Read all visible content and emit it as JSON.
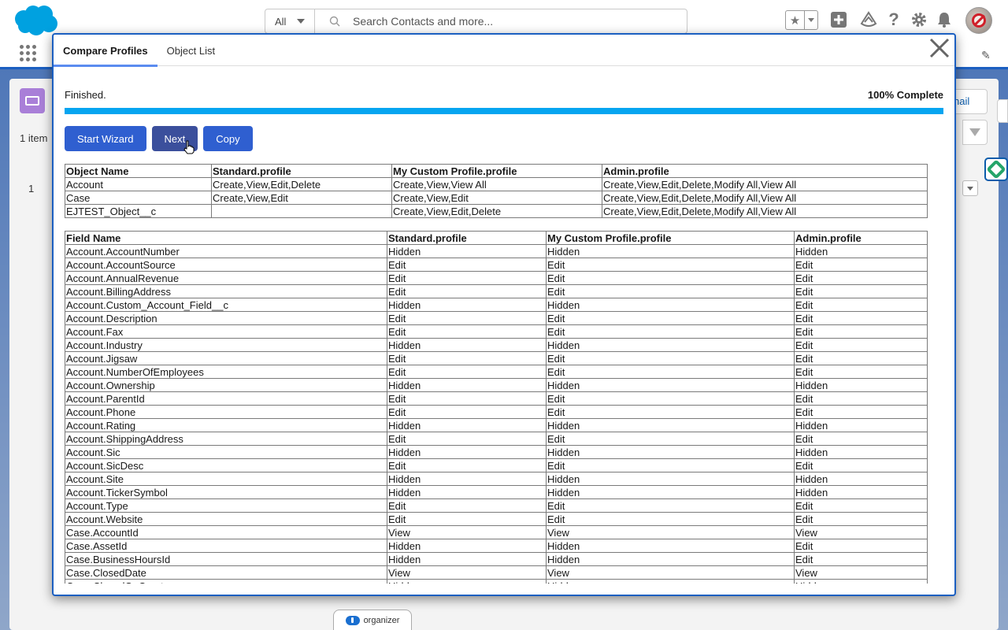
{
  "header": {
    "search_scope": "All",
    "search_placeholder": "Search Contacts and more...",
    "icons": [
      "favorites-star-icon",
      "favorites-dropdown-icon",
      "global-create-icon",
      "trailhead-icon",
      "help-icon",
      "setup-gear-icon",
      "notifications-bell-icon",
      "user-avatar"
    ]
  },
  "background": {
    "items_count": "1 item",
    "row_number": "1",
    "email_button_partial": "nail"
  },
  "modal": {
    "tabs": [
      {
        "label": "Compare Profiles",
        "active": true
      },
      {
        "label": "Object List",
        "active": false
      }
    ],
    "status": "Finished.",
    "progress_label": "100% Complete",
    "progress_percent": 100,
    "buttons": {
      "start_wizard": "Start Wizard",
      "next": "Next",
      "copy": "Copy"
    },
    "objects_table": {
      "headers": [
        "Object Name",
        "Standard.profile",
        "My Custom Profile.profile",
        "Admin.profile"
      ],
      "rows": [
        [
          "Account",
          "Create,View,Edit,Delete",
          "Create,View,View All",
          "Create,View,Edit,Delete,Modify All,View All"
        ],
        [
          "Case",
          "Create,View,Edit",
          "Create,View,Edit",
          "Create,View,Edit,Delete,Modify All,View All"
        ],
        [
          "EJTEST_Object__c",
          "",
          "Create,View,Edit,Delete",
          "Create,View,Edit,Delete,Modify All,View All"
        ]
      ]
    },
    "fields_table": {
      "headers": [
        "Field Name",
        "Standard.profile",
        "My Custom Profile.profile",
        "Admin.profile"
      ],
      "rows": [
        [
          "Account.AccountNumber",
          "Hidden",
          "Hidden",
          "Hidden"
        ],
        [
          "Account.AccountSource",
          "Edit",
          "Edit",
          "Edit"
        ],
        [
          "Account.AnnualRevenue",
          "Edit",
          "Edit",
          "Edit"
        ],
        [
          "Account.BillingAddress",
          "Edit",
          "Edit",
          "Edit"
        ],
        [
          "Account.Custom_Account_Field__c",
          "Hidden",
          "Hidden",
          "Edit"
        ],
        [
          "Account.Description",
          "Edit",
          "Edit",
          "Edit"
        ],
        [
          "Account.Fax",
          "Edit",
          "Edit",
          "Edit"
        ],
        [
          "Account.Industry",
          "Hidden",
          "Hidden",
          "Edit"
        ],
        [
          "Account.Jigsaw",
          "Edit",
          "Edit",
          "Edit"
        ],
        [
          "Account.NumberOfEmployees",
          "Edit",
          "Edit",
          "Edit"
        ],
        [
          "Account.Ownership",
          "Hidden",
          "Hidden",
          "Hidden"
        ],
        [
          "Account.ParentId",
          "Edit",
          "Edit",
          "Edit"
        ],
        [
          "Account.Phone",
          "Edit",
          "Edit",
          "Edit"
        ],
        [
          "Account.Rating",
          "Hidden",
          "Hidden",
          "Hidden"
        ],
        [
          "Account.ShippingAddress",
          "Edit",
          "Edit",
          "Edit"
        ],
        [
          "Account.Sic",
          "Hidden",
          "Hidden",
          "Hidden"
        ],
        [
          "Account.SicDesc",
          "Edit",
          "Edit",
          "Edit"
        ],
        [
          "Account.Site",
          "Hidden",
          "Hidden",
          "Hidden"
        ],
        [
          "Account.TickerSymbol",
          "Hidden",
          "Hidden",
          "Hidden"
        ],
        [
          "Account.Type",
          "Edit",
          "Edit",
          "Edit"
        ],
        [
          "Account.Website",
          "Edit",
          "Edit",
          "Edit"
        ],
        [
          "Case.AccountId",
          "View",
          "View",
          "View"
        ],
        [
          "Case.AssetId",
          "Hidden",
          "Hidden",
          "Edit"
        ],
        [
          "Case.BusinessHoursId",
          "Hidden",
          "Hidden",
          "Edit"
        ],
        [
          "Case.ClosedDate",
          "View",
          "View",
          "View"
        ],
        [
          "Case.ClosedOnCreate",
          "Hidden",
          "Hidden",
          "Hidden"
        ]
      ]
    }
  },
  "footer": {
    "organizer_label": "organizer"
  },
  "colors": {
    "brand_blue": "#1b5fc1",
    "button_blue": "#2f5fd0",
    "button_hover": "#3b4f9c",
    "progress": "#06a5f0",
    "salesforce_cloud": "#00a1e0"
  }
}
